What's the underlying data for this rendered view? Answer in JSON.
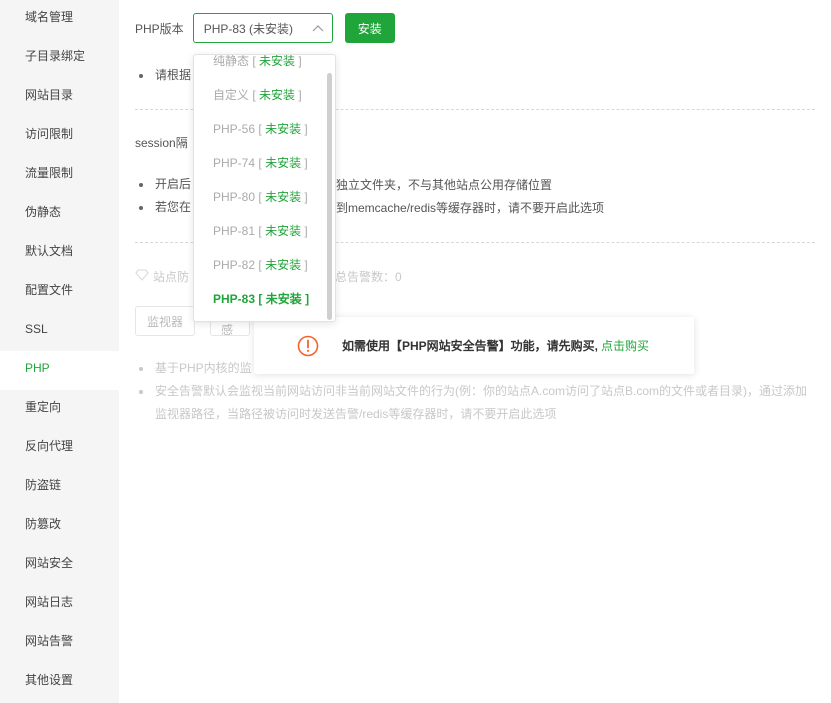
{
  "sidebar": {
    "items": [
      {
        "label": "域名管理"
      },
      {
        "label": "子目录绑定"
      },
      {
        "label": "网站目录"
      },
      {
        "label": "访问限制"
      },
      {
        "label": "流量限制"
      },
      {
        "label": "伪静态"
      },
      {
        "label": "默认文档"
      },
      {
        "label": "配置文件"
      },
      {
        "label": "SSL"
      },
      {
        "label": "PHP"
      },
      {
        "label": "重定向"
      },
      {
        "label": "反向代理"
      },
      {
        "label": "防盗链"
      },
      {
        "label": "防篡改"
      },
      {
        "label": "网站安全"
      },
      {
        "label": "网站日志"
      },
      {
        "label": "网站告警"
      },
      {
        "label": "其他设置"
      }
    ],
    "active": "PHP"
  },
  "php": {
    "version_label": "PHP版本",
    "selected_version": "PHP-83 (未安装)",
    "install_button": "安装",
    "note": "请根据"
  },
  "dropdown": {
    "options": [
      {
        "name": "纯静态",
        "status": "未安装"
      },
      {
        "name": "自定义",
        "status": "未安装"
      },
      {
        "name": "PHP-56",
        "status": "未安装"
      },
      {
        "name": "PHP-74",
        "status": "未安装"
      },
      {
        "name": "PHP-80",
        "status": "未安装"
      },
      {
        "name": "PHP-81",
        "status": "未安装"
      },
      {
        "name": "PHP-82",
        "status": "未安装"
      },
      {
        "name": "PHP-83",
        "status": "未安装"
      }
    ],
    "selected_index": 7,
    "bracket_open": "[",
    "bracket_close": "]"
  },
  "session": {
    "title": "session隔",
    "bullet1_head": "开启后",
    "bullet1_tail": "独立文件夹，不与其他站点公用存储位置",
    "bullet2_head": "若您在",
    "bullet2_tail": "到memcache/redis等缓存器时，请不要开启此选项"
  },
  "guard": {
    "label": "站点防",
    "count": "总告警数：0",
    "monitor_button": "监视器",
    "monitor_button2": "敏感"
  },
  "alert": {
    "text": "如需使用【PHP网站安全告警】功能，请先购买,",
    "link": "点击购买"
  },
  "notes": {
    "item1": "基于PHP内核的监",
    "item2": "安全告警默认会监视当前网站访问非当前网站文件的行为(例：你的站点A.com访问了站点B.com的文件或者目录)，通过添加",
    "item3": "监视器路径，当路径被访问时发送告警/redis等缓存器时，请不要开启此选项"
  },
  "colors": {
    "accent": "#20a53a",
    "warning": "#f0642c",
    "sidebar_bg": "#f5f5f5"
  },
  "icons": {
    "select_arrow": "chevron-up-icon",
    "alert": "warning-circle-icon",
    "guard": "diamond-icon"
  }
}
